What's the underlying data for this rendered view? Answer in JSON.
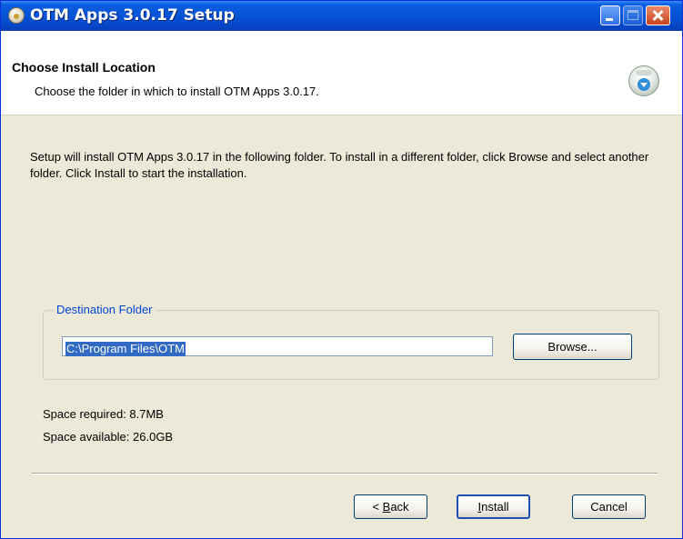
{
  "window": {
    "title": "OTM Apps 3.0.17 Setup"
  },
  "header": {
    "title": "Choose Install Location",
    "subtitle": "Choose the folder in which to install OTM Apps 3.0.17."
  },
  "body": {
    "description": "Setup will install OTM Apps 3.0.17 in the following folder. To install in a different folder, click Browse and select another folder. Click Install to start the installation."
  },
  "destination": {
    "legend": "Destination Folder",
    "path_value": "C:\\Program Files\\OTM",
    "browse_label": "Browse..."
  },
  "space": {
    "required": "Space required: 8.7MB",
    "available": "Space available: 26.0GB"
  },
  "buttons": {
    "back_prefix": "< ",
    "back_mnemonic": "B",
    "back_rest": "ack",
    "install_mnemonic": "I",
    "install_rest": "nstall",
    "cancel_label": "Cancel"
  },
  "icons": {
    "app": "installer-disk-icon",
    "header": "install-download-icon"
  },
  "colors": {
    "titlebar": "#0653d6",
    "dialog_background": "#ece9d8",
    "selection": "#316ac5",
    "group_legend": "#0046d5"
  }
}
